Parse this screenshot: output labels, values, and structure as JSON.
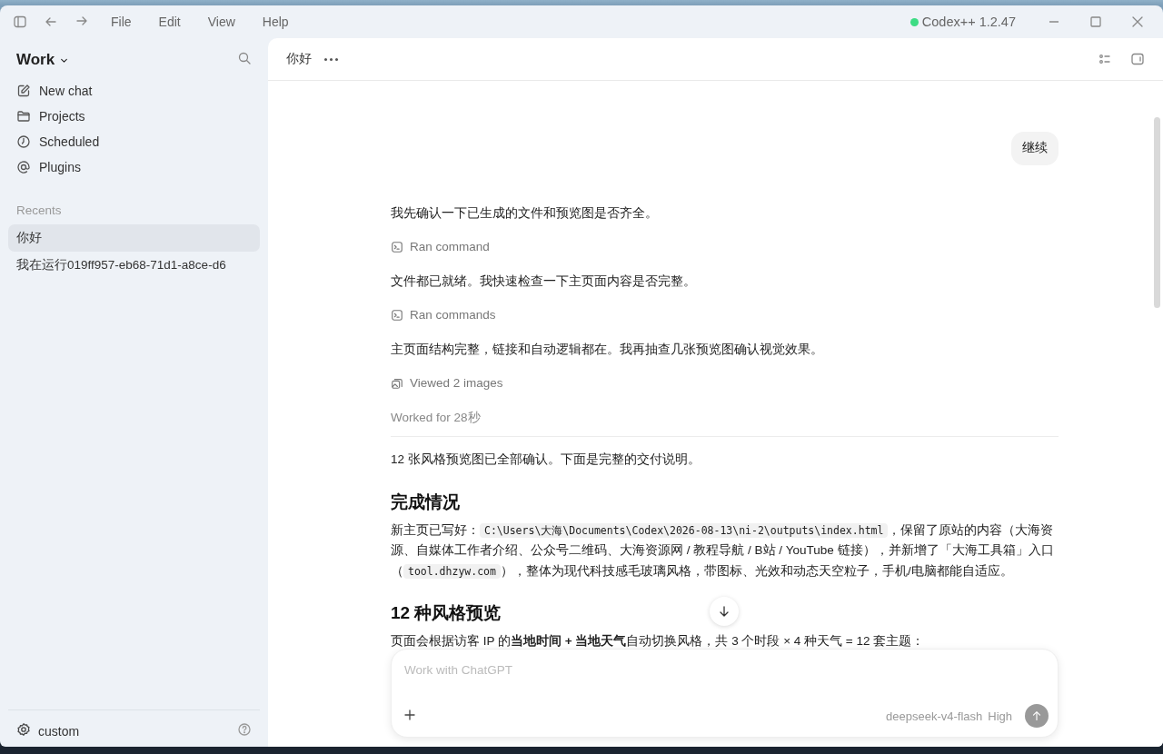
{
  "titlebar": {
    "menus": [
      "File",
      "Edit",
      "View",
      "Help"
    ],
    "app_name": "Codex++ 1.2.47"
  },
  "sidebar": {
    "workspace": "Work",
    "nav": [
      {
        "label": "New chat",
        "kind": "edit"
      },
      {
        "label": "Projects",
        "kind": "folder"
      },
      {
        "label": "Scheduled",
        "kind": "clock"
      },
      {
        "label": "Plugins",
        "kind": "at"
      }
    ],
    "recents_label": "Recents",
    "recents": [
      {
        "label": "你好",
        "selected": true
      },
      {
        "label": "我在运行019ff957-eb68-71d1-a8ce-d6",
        "selected": false
      }
    ],
    "footer": {
      "label": "custom"
    }
  },
  "chat": {
    "title": "你好",
    "messages": [
      {
        "kind": "user",
        "text": "继续"
      },
      {
        "kind": "text",
        "text": "我先确认一下已生成的文件和预览图是否齐全。"
      },
      {
        "kind": "command",
        "text": "Ran command"
      },
      {
        "kind": "text",
        "text": "文件都已就绪。我快速检查一下主页面内容是否完整。"
      },
      {
        "kind": "command",
        "text": "Ran commands"
      },
      {
        "kind": "text",
        "text": "主页面结构完整，链接和自动逻辑都在。我再抽查几张预览图确认视觉效果。"
      },
      {
        "kind": "images",
        "text": "Viewed 2 images"
      },
      {
        "kind": "worked",
        "text": "Worked for 28秒"
      },
      {
        "kind": "text",
        "text": "12 张风格预览图已全部确认。下面是完整的交付说明。"
      },
      {
        "kind": "heading",
        "text": "完成情况"
      },
      {
        "kind": "rich",
        "segments": [
          {
            "kind": "text",
            "text": "新主页已写好："
          },
          {
            "kind": "code",
            "text": "C:\\Users\\大海\\Documents\\Codex\\2026-08-13\\ni-2\\outputs\\index.html"
          },
          {
            "kind": "text",
            "text": "，保留了原站的内容（大海资源、自媒体工作者介绍、公众号二维码、大海资源网 / 教程导航 / B站 / YouTube 链接），并新增了「大海工具箱」入口（"
          },
          {
            "kind": "code",
            "text": "tool.dhzyw.com"
          },
          {
            "kind": "text",
            "text": "），整体为现代科技感毛玻璃风格，带图标、光效和动态天空粒子，手机/电脑都能自适应。"
          }
        ]
      },
      {
        "kind": "heading",
        "text": "12 种风格预览"
      },
      {
        "kind": "text",
        "text": "页面会根据访客 IP 的**当地时间 + 当地天气**自动切换风格，共 3 个时段 × 4 种天气 = 12 套主题："
      }
    ]
  },
  "composer": {
    "placeholder": "Work with ChatGPT",
    "model": "deepseek-v4-flash",
    "effort": "High"
  }
}
